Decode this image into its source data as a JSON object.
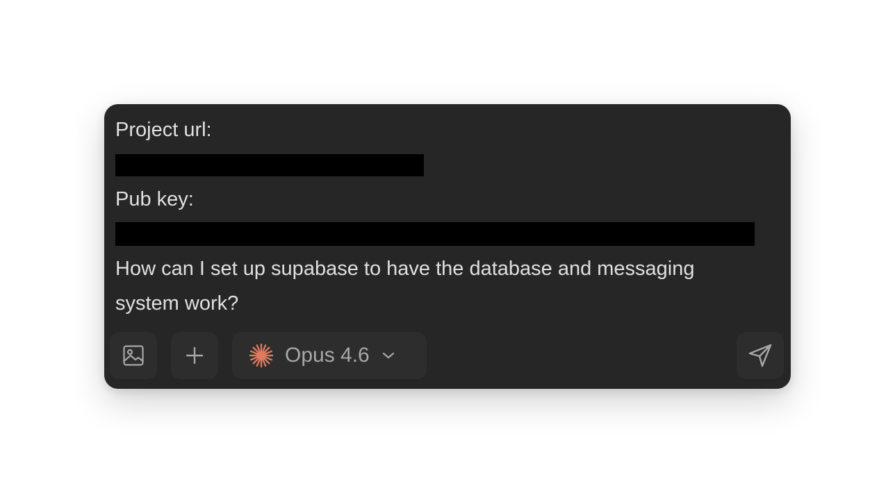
{
  "message": {
    "line1": "Project url:",
    "line2": "Pub key:",
    "line3": "How can I set up supabase to have the database and messaging",
    "line4": "system work?"
  },
  "toolbar": {
    "model_label": "Opus 4.6",
    "accent_color": "#e07a5f",
    "icons": [
      "image-icon",
      "plus-icon",
      "sparkle-icon",
      "chevron-down-icon",
      "send-icon"
    ]
  }
}
